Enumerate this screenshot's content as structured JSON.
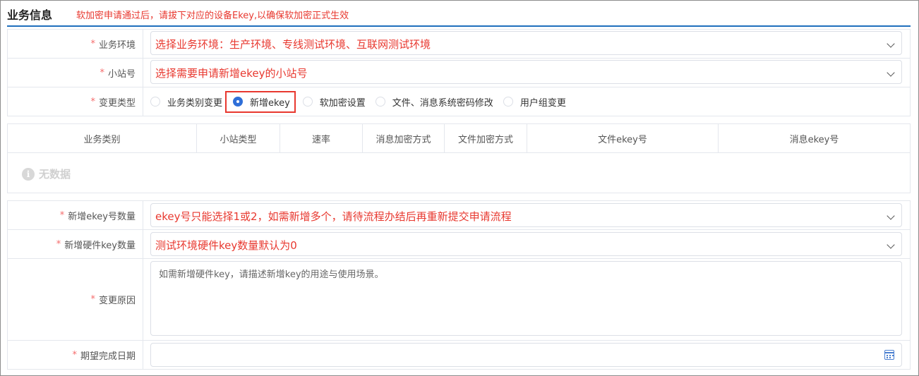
{
  "section": {
    "title": "业务信息",
    "note": "软加密申请通过后，请拔下对应的设备Ekey,以确保软加密正式生效"
  },
  "form_top": {
    "env": {
      "label": "业务环境",
      "value": "选择业务环境：生产环境、专线测试环境、互联网测试环境"
    },
    "station": {
      "label": "小站号",
      "value": "选择需要申请新增ekey的小站号"
    },
    "change_type": {
      "label": "变更类型",
      "options": [
        "业务类别变更",
        "新增ekey",
        "软加密设置",
        "文件、消息系统密码修改",
        "用户组变更"
      ],
      "selected": "新增ekey"
    }
  },
  "table": {
    "columns": [
      "业务类别",
      "小站类型",
      "速率",
      "消息加密方式",
      "文件加密方式",
      "文件ekey号",
      "消息ekey号"
    ],
    "rows": [],
    "empty_text": "无数据"
  },
  "form_bottom": {
    "ekey_count": {
      "label": "新增ekey号数量",
      "value": "ekey号只能选择1或2，如需新增多个，请待流程办结后再重新提交申请流程"
    },
    "hw_key_count": {
      "label": "新增硬件key数量",
      "value": "测试环境硬件key数量默认为0"
    },
    "reason": {
      "label": "变更原因",
      "placeholder": "如需新增硬件key，请描述新增key的用途与使用场景。"
    },
    "date": {
      "label": "期望完成日期",
      "value": ""
    }
  },
  "required_mark": "*",
  "colors": {
    "accent": "#1f6fbd",
    "annotation": "#e8382f",
    "radio_selected": "#2f6fd8",
    "required": "#f56c6c"
  }
}
